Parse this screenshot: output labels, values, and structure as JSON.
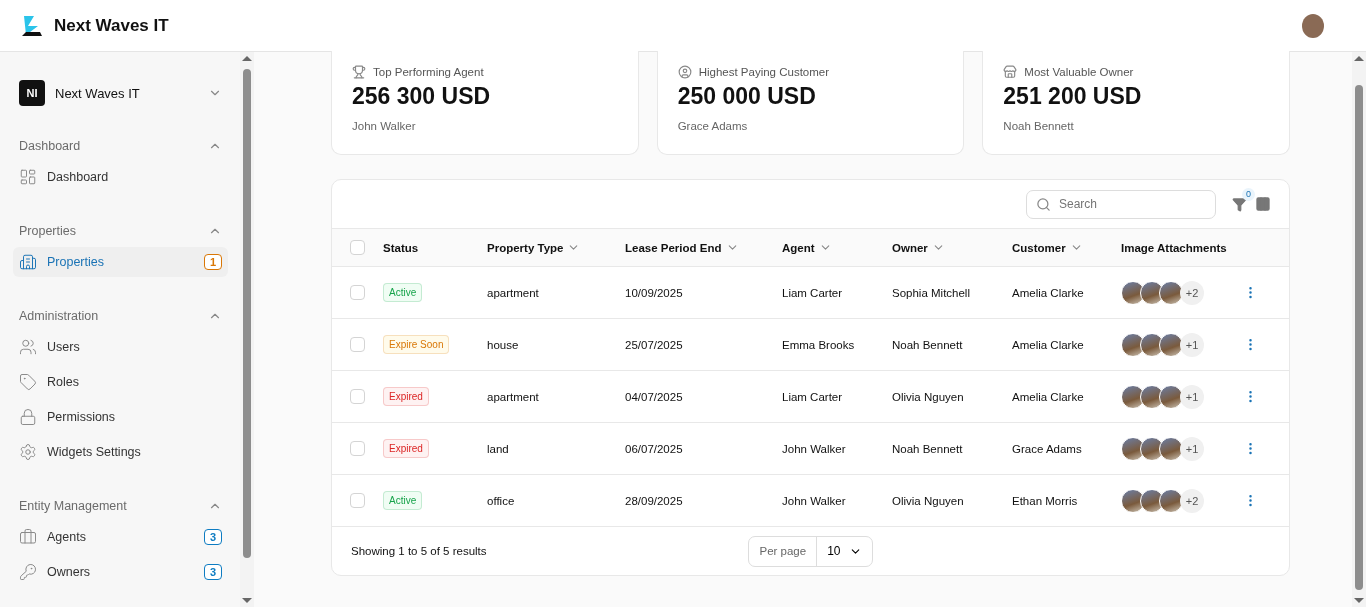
{
  "header": {
    "brand": "Next Waves IT"
  },
  "sidebar": {
    "org": {
      "initials": "NI",
      "name": "Next Waves IT"
    },
    "sections": [
      {
        "title": "Dashboard",
        "expanded": true,
        "items": [
          {
            "label": "Dashboard",
            "selected": false
          }
        ]
      },
      {
        "title": "Properties",
        "expanded": true,
        "items": [
          {
            "label": "Properties",
            "selected": true,
            "badge": {
              "text": "1",
              "color": "#d97706"
            }
          }
        ]
      },
      {
        "title": "Administration",
        "expanded": true,
        "items": [
          {
            "label": "Users",
            "selected": false
          },
          {
            "label": "Roles",
            "selected": false
          },
          {
            "label": "Permissions",
            "selected": false
          },
          {
            "label": "Widgets Settings",
            "selected": false
          }
        ]
      },
      {
        "title": "Entity Management",
        "expanded": true,
        "items": [
          {
            "label": "Agents",
            "selected": false,
            "badge": {
              "text": "3",
              "color": "#0e7cc2"
            }
          },
          {
            "label": "Owners",
            "selected": false,
            "badge": {
              "text": "3",
              "color": "#0e7cc2"
            }
          }
        ]
      }
    ]
  },
  "stats": [
    {
      "label": "Top Performing Agent",
      "value": "256 300 USD",
      "name": "John Walker"
    },
    {
      "label": "Highest Paying Customer",
      "value": "250 000 USD",
      "name": "Grace Adams"
    },
    {
      "label": "Most Valuable Owner",
      "value": "251 200 USD",
      "name": "Noah Bennett"
    }
  ],
  "table": {
    "search": {
      "placeholder": "Search"
    },
    "filter_count": "0",
    "all_checked": false,
    "columns": [
      {
        "label": "Status",
        "sortable": false
      },
      {
        "label": "Property Type",
        "sortable": true
      },
      {
        "label": "Lease Period End",
        "sortable": true
      },
      {
        "label": "Agent",
        "sortable": true
      },
      {
        "label": "Owner",
        "sortable": true
      },
      {
        "label": "Customer",
        "sortable": true
      },
      {
        "label": "Image Attachments",
        "sortable": false
      }
    ],
    "rows": [
      {
        "checked": false,
        "status": {
          "text": "Active",
          "kind": "active"
        },
        "type": "apartment",
        "lease_end": "10/09/2025",
        "agent": "Liam Carter",
        "owner": "Sophia Mitchell",
        "customer": "Amelia Clarke",
        "more_images": "+2"
      },
      {
        "checked": false,
        "status": {
          "text": "Expire Soon",
          "kind": "soon"
        },
        "type": "house",
        "lease_end": "25/07/2025",
        "agent": "Emma Brooks",
        "owner": "Noah Bennett",
        "customer": "Amelia Clarke",
        "more_images": "+1"
      },
      {
        "checked": false,
        "status": {
          "text": "Expired",
          "kind": "expired"
        },
        "type": "apartment",
        "lease_end": "04/07/2025",
        "agent": "Liam Carter",
        "owner": "Olivia Nguyen",
        "customer": "Amelia Clarke",
        "more_images": "+1"
      },
      {
        "checked": false,
        "status": {
          "text": "Expired",
          "kind": "expired"
        },
        "type": "land",
        "lease_end": "06/07/2025",
        "agent": "John Walker",
        "owner": "Noah Bennett",
        "customer": "Grace Adams",
        "more_images": "+1"
      },
      {
        "checked": false,
        "status": {
          "text": "Active",
          "kind": "active"
        },
        "type": "office",
        "lease_end": "28/09/2025",
        "agent": "John Walker",
        "owner": "Olivia Nguyen",
        "customer": "Ethan Morris",
        "more_images": "+2"
      }
    ],
    "footer": {
      "summary": "Showing 1 to 5 of 5 results",
      "per_page_label": "Per page",
      "per_page_value": "10"
    }
  }
}
